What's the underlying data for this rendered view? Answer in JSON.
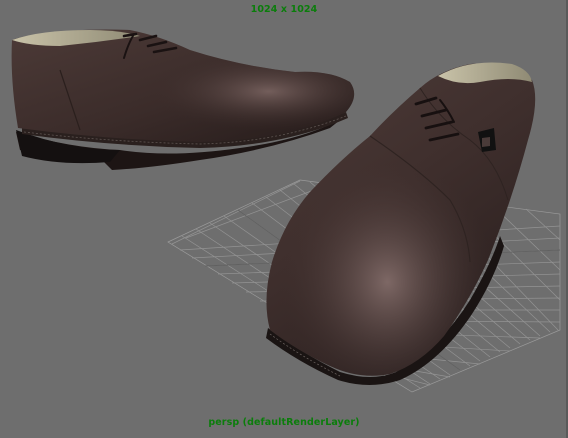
{
  "viewport": {
    "resolution_gate_label": "1024 x 1024",
    "camera_label": "persp (defaultRenderLayer)"
  },
  "colors": {
    "background": "#6e6e6e",
    "hud_text": "#0b7d0b",
    "grid_lines": "#9a9a9a",
    "shoe_leather": "#3f2f2d"
  },
  "scene": {
    "objects": [
      "left-shoe",
      "right-shoe"
    ],
    "grid_visible": true
  }
}
